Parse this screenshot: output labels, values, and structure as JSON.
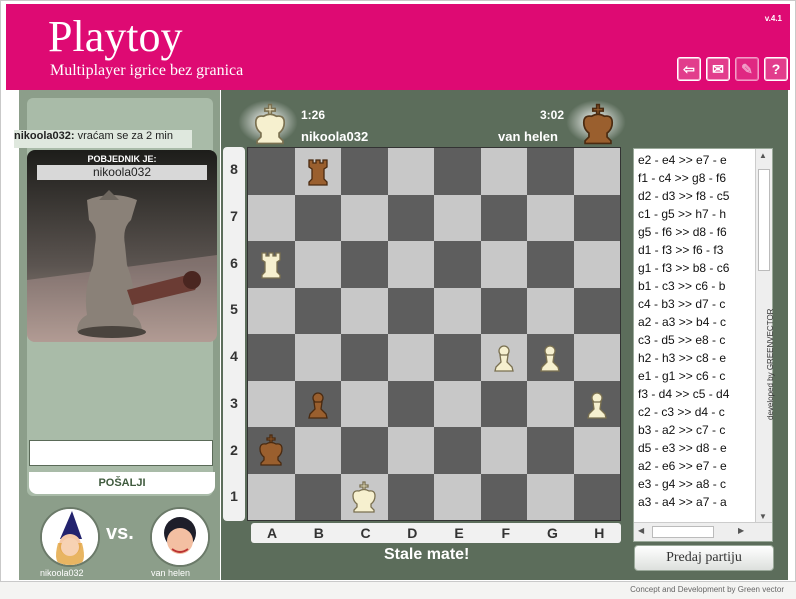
{
  "header": {
    "logo": "Playtoy",
    "tagline": "Multiplayer igrice bez granica",
    "version": "v.4.1",
    "buttons": [
      {
        "name": "back-button",
        "icon": "back-arrow-icon",
        "glyph": "⇦"
      },
      {
        "name": "mail-button",
        "icon": "mail-icon",
        "glyph": "✉"
      },
      {
        "name": "settings-button",
        "icon": "wrench-icon",
        "glyph": "✎"
      },
      {
        "name": "help-button",
        "icon": "help-icon",
        "glyph": "?"
      }
    ]
  },
  "chat": {
    "sender": "nikoola032:",
    "message": "vraćam se za 2 min",
    "send_label": "POŠALJI"
  },
  "winner": {
    "label": "POBJEDNIK JE:",
    "name": "nikoola032"
  },
  "players": {
    "vs": "vs.",
    "white": {
      "name": "nikoola032",
      "time": "1:26"
    },
    "black": {
      "name": "van helen",
      "time": "3:02"
    }
  },
  "board": {
    "ranks": [
      "8",
      "7",
      "6",
      "5",
      "4",
      "3",
      "2",
      "1"
    ],
    "files": [
      "A",
      "B",
      "C",
      "D",
      "E",
      "F",
      "G",
      "H"
    ],
    "pieces": [
      {
        "square": "b8",
        "piece": "rook",
        "color": "black"
      },
      {
        "square": "a6",
        "piece": "rook",
        "color": "white"
      },
      {
        "square": "f4",
        "piece": "pawn",
        "color": "white"
      },
      {
        "square": "g4",
        "piece": "pawn",
        "color": "white"
      },
      {
        "square": "b3",
        "piece": "pawn",
        "color": "black"
      },
      {
        "square": "h3",
        "piece": "pawn",
        "color": "white"
      },
      {
        "square": "a2",
        "piece": "king",
        "color": "black"
      },
      {
        "square": "c1",
        "piece": "king",
        "color": "white"
      }
    ],
    "status": "Stale mate!"
  },
  "moves": [
    "e2 - e4  >>  e7 - e",
    "f1 - c4  >>  g8 - f6",
    "d2 - d3  >>  f8 - c5",
    "c1 - g5  >>  h7 - h",
    "g5 - f6  >>  d8 - f6",
    "d1 - f3  >>  f6 - f3",
    "g1 - f3  >>  b8 - c6",
    "b1 - c3  >>  c6 - b",
    "c4 - b3  >>  d7 - c",
    "a2 - a3  >>  b4 - c",
    "c3 - d5  >>  e8 - c",
    "h2 - h3  >>  c8 - e",
    "e1 - g1  >>  c6 - c",
    "f3 - d4  >>  c5 - d4",
    "c2 - c3  >>  d4 - c",
    "b3 - a2  >>  c7 - c",
    "d5 - e3  >>  d8 - e",
    "a2 - e6  >>  e7 - e",
    "e3 - g4  >>  a8 - c",
    "a3 - a4  >>  a7 - a"
  ],
  "resign_label": "Predaj partiju",
  "developed_by": "developed by GREENVECTOR",
  "footer": "Concept and Development by Green vector",
  "colors": {
    "brand": "#de0a73",
    "panel": "#5c6d5b",
    "light_square": "#c8c8c8",
    "dark_square": "#5e5e5e"
  }
}
